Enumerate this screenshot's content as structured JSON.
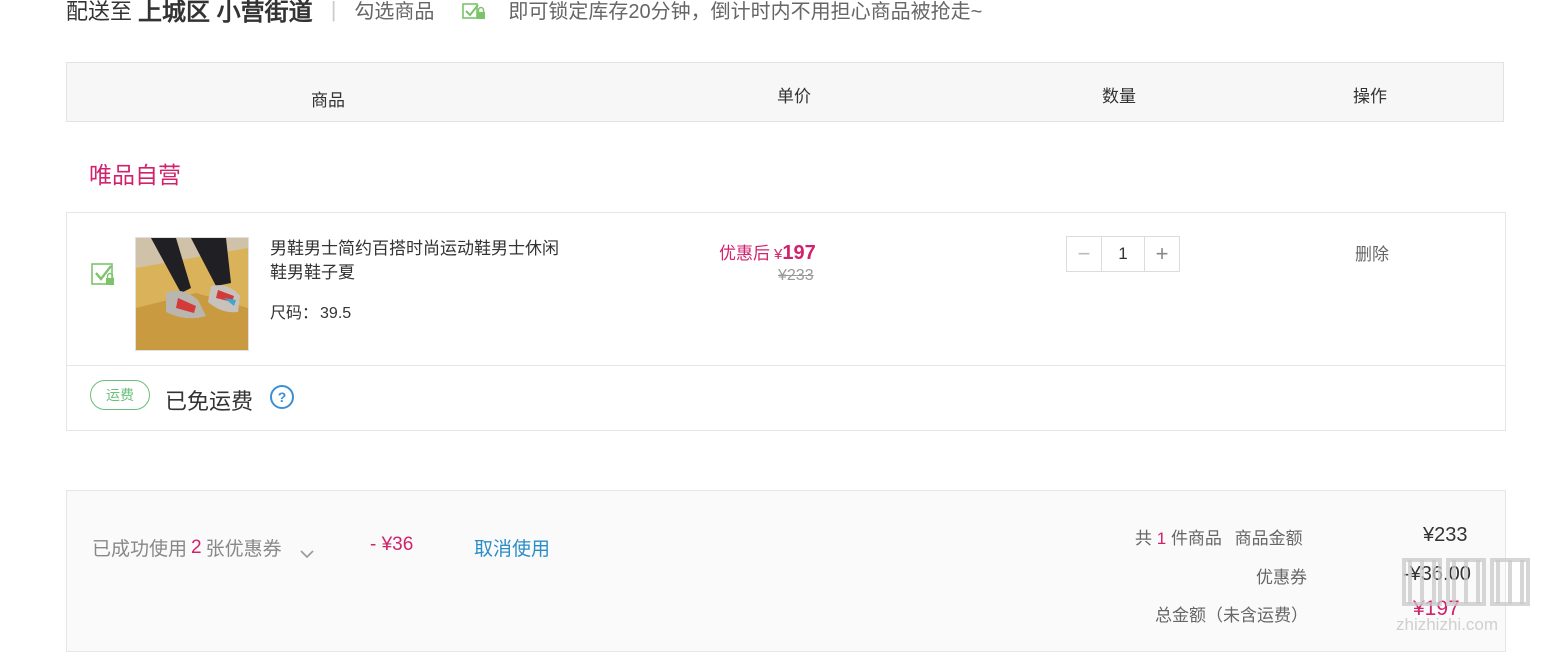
{
  "delivery": {
    "prefix": "配送至",
    "area": "上城区 小营街道",
    "separator": "|",
    "hint_select": "勾选商品",
    "hint_lock": "即可锁定库存20分钟，倒计时内不用担心商品被抢走~",
    "icon": "lock-checkbox-icon"
  },
  "table_header": {
    "col_product": "商品",
    "col_price": "单价",
    "col_qty": "数量",
    "col_action": "操作"
  },
  "store": {
    "name": "唯品自营"
  },
  "item": {
    "checked": true,
    "name": "男鞋男士简约百搭时尚运动鞋男士休闲鞋男鞋子夏",
    "size_label": "尺码：",
    "size_value": "39.5",
    "discount_label": "优惠后",
    "currency": "¥",
    "price_now": "197",
    "price_old": "¥233",
    "quantity": "1",
    "minus": "−",
    "plus": "+",
    "delete_label": "删除"
  },
  "shipping": {
    "badge": "运费",
    "text": "已免运费",
    "help": "?"
  },
  "summary": {
    "coupon_prefix": "已成功使用",
    "coupon_count": "2",
    "coupon_suffix": "张优惠券",
    "coupon_discount": "- ¥36",
    "cancel_label": "取消使用",
    "count_prefix": "共",
    "count_value": "1",
    "count_suffix": "件商品",
    "goods_amount_label": "商品金额",
    "goods_amount_value": "¥233",
    "coupon_label": "优惠券",
    "coupon_value": "-¥36.00",
    "total_label": "总金额（未含运费）",
    "total_value": "¥197"
  },
  "colors": {
    "accent": "#d1226c",
    "link": "#2a8dc9",
    "ship_green": "#6abf7b"
  },
  "watermark": {
    "text": "值 什么值得买",
    "domain": "zhizhizhi.com"
  }
}
